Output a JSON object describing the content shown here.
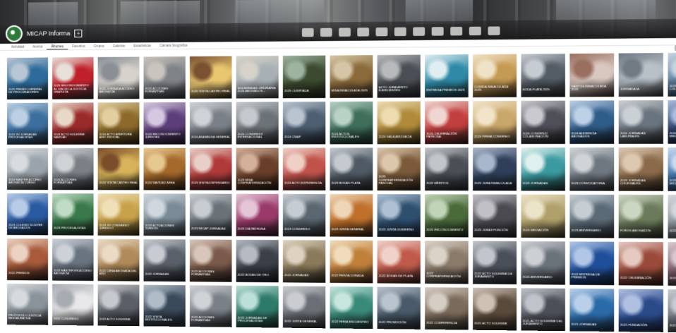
{
  "profile": {
    "title": "MICAP Informa",
    "add_symbol": "+"
  },
  "stats": [
    "",
    "",
    ""
  ],
  "cover_actions": [
    "",
    ""
  ],
  "tabs": [
    {
      "label": "Actividad",
      "active": false
    },
    {
      "label": "Acerca",
      "active": false
    },
    {
      "label": "Álbumes",
      "active": true
    },
    {
      "label": "Favoritos",
      "active": false
    },
    {
      "label": "Grupos",
      "active": false
    },
    {
      "label": "Galerías",
      "active": false
    },
    {
      "label": "Estadísticas",
      "active": false
    },
    {
      "label": "Cámara fotográfica",
      "active": false
    }
  ],
  "tile_meta": "",
  "tiles": [
    {
      "title": "2025 PREMIO GENERAL DE PROCURADORES",
      "palette": [
        "#2c6b9a",
        "#b9c7d4",
        "#1d1f22"
      ]
    },
    {
      "title": "2025 RECONOCIMIENTO AL DÍA DE LA JUSTICIA GRATUITA",
      "palette": [
        "#c0202a",
        "#e6e0d8",
        "#2c2c2f"
      ]
    },
    {
      "title": "2025 JORNADA ACCESO ABOGACÍA",
      "palette": [
        "#d7d3cc",
        "#8a8f96",
        "#3b3c40"
      ]
    },
    {
      "title": "2025 ACCIONES FORMATIVAS",
      "palette": [
        "#7f8287",
        "#c9c4bd",
        "#2b2d31"
      ]
    },
    {
      "title": "2025 Visita Castro Real",
      "palette": [
        "#e9c770",
        "#7a5232",
        "#2c2219"
      ]
    },
    {
      "title": "Solemnidad Ordinaria 2025 Abogados...",
      "palette": [
        "#a7b0b4",
        "#d6d2c9",
        "#3b3a3a"
      ]
    },
    {
      "title": "2025 Olimpiada",
      "palette": [
        "#3c4b2f",
        "#9fb4a0",
        "#20241e"
      ]
    },
    {
      "title": "Misa Inmaculada 2025",
      "palette": [
        "#8a6a3a",
        "#d6c6a7",
        "#2a2420"
      ]
    },
    {
      "title": "Acto Juramento Ejercientes",
      "palette": [
        "#4a4f55",
        "#b7b9bb",
        "#222428"
      ]
    },
    {
      "title": "Entrega Premios 2025",
      "palette": [
        "#2e8aa7",
        "#e0eef2",
        "#1c2a30"
      ]
    },
    {
      "title": "Comida Inmaculada 2025",
      "palette": [
        "#c59a52",
        "#f0e2c6",
        "#3a2a1a"
      ]
    },
    {
      "title": "Boda Plata 2025",
      "palette": [
        "#545c66",
        "#c7ccd3",
        "#25282c"
      ]
    },
    {
      "title": "Santos Inmaculada 2025",
      "palette": [
        "#d9c8c0",
        "#9a6f5f",
        "#2c2422"
      ]
    },
    {
      "title": "Jornada IA",
      "palette": [
        "#b8c0c8",
        "#707a84",
        "#2a2e33"
      ]
    },
    {
      "title": "2025 Asamblea Colegial",
      "palette": [
        "#5a7fa0",
        "#c8d5e0",
        "#202630"
      ]
    },
    {
      "title": "2024 XV Jornadas Procesalistas",
      "palette": [
        "#3c6e9e",
        "#bcd0e2",
        "#1f2530"
      ]
    },
    {
      "title": "2024 Acto Solemne Navidad",
      "palette": [
        "#9b2a2a",
        "#e8d8c8",
        "#2a1c1c"
      ]
    },
    {
      "title": "2024 Acto Apertura Año Judicial",
      "palette": [
        "#8c6a2a",
        "#e2cfa0",
        "#2a2114"
      ]
    },
    {
      "title": "2024 Reconocimiento Juristas",
      "palette": [
        "#5c3f7a",
        "#d6c8e2",
        "#241c2c"
      ]
    },
    {
      "title": "2024 Asamblea General",
      "palette": [
        "#7a8088",
        "#cfd2d6",
        "#26282c"
      ]
    },
    {
      "title": "2024 Congreso Internacional",
      "palette": [
        "#6c7378",
        "#c4c9cd",
        "#24272a"
      ]
    },
    {
      "title": "2024 CMAP",
      "palette": [
        "#4d5f72",
        "#b9c4cf",
        "#20262d"
      ]
    },
    {
      "title": "2024 Actos Institucionales",
      "palette": [
        "#3f6f5a",
        "#b8d2c6",
        "#1c2a24"
      ]
    },
    {
      "title": "2024 Gala Abogacía",
      "palette": [
        "#b08a3a",
        "#ecdcb0",
        "#2c2414"
      ]
    },
    {
      "title": "2024 Celebración Patrona",
      "palette": [
        "#c23f3f",
        "#f0d6d0",
        "#2e1c1c"
      ]
    },
    {
      "title": "2024 Firma Convenio",
      "palette": [
        "#c9a66a",
        "#f2e4c8",
        "#30281c"
      ]
    },
    {
      "title": "2024 Convenio Colaboración",
      "palette": [
        "#4f4f58",
        "#c9c9cf",
        "#222226"
      ]
    },
    {
      "title": "2024 Audiencia Abogados",
      "palette": [
        "#2f5d8a",
        "#bcd0e6",
        "#1c2430"
      ]
    },
    {
      "title": "2024 Jornadas Laborales",
      "palette": [
        "#6a747e",
        "#cbd0d5",
        "#25282b"
      ]
    },
    {
      "title": "2024 Seminario Mediación",
      "palette": [
        "#2b3f6a",
        "#a9bde0",
        "#182030"
      ]
    },
    {
      "title": "2024 MASTER ACCESO ABOGACÍA CURSO",
      "palette": [
        "#9aa3ab",
        "#d8dcdf",
        "#2d3034"
      ]
    },
    {
      "title": "2024 ACCIONES FORMATIVAS",
      "palette": [
        "#7a8086",
        "#d0d3d6",
        "#26282b"
      ]
    },
    {
      "title": "2024 Visita Castro Real",
      "palette": [
        "#d8b35a",
        "#7a4e2a",
        "#2c2016"
      ]
    },
    {
      "title": "2024 NAVIDAD ÁREA",
      "palette": [
        "#a4682a",
        "#e6c890",
        "#2c1e12"
      ]
    },
    {
      "title": "2023 VISITA DISPENSARIO",
      "palette": [
        "#b03a3a",
        "#e8cfc8",
        "#2c1a1a"
      ]
    },
    {
      "title": "2023 MISA CONFRATERNIZACIÓN",
      "palette": [
        "#6a3f2a",
        "#d2b09a",
        "#24180f"
      ]
    },
    {
      "title": "2023 ACTO EXPERIENCIA",
      "palette": [
        "#c0524a",
        "#efd0c6",
        "#2e1e1a"
      ]
    },
    {
      "title": "2023 BODAS PLATA",
      "palette": [
        "#505a64",
        "#c4cad0",
        "#22262a"
      ]
    },
    {
      "title": "2023 CONFRATERNIZACIÓN PASCUAL",
      "palette": [
        "#7a5a3a",
        "#dcc6ac",
        "#2a2016"
      ]
    },
    {
      "title": "2023 MÉRITOS",
      "palette": [
        "#4a4f55",
        "#c2c6ca",
        "#232528"
      ]
    },
    {
      "title": "2023 JURA INMACULADA",
      "palette": [
        "#2f3f5a",
        "#aab6ca",
        "#1a1f28"
      ]
    },
    {
      "title": "2023 JORNADAS",
      "palette": [
        "#3a9aa0",
        "#e0f0ee",
        "#1c2c2e"
      ]
    },
    {
      "title": "2023 CONVOCATORIA",
      "palette": [
        "#6f7880",
        "#cfd4d8",
        "#25292c"
      ]
    },
    {
      "title": "2023 JORNADAS COLEGIALES",
      "palette": [
        "#8a6a4a",
        "#ddc8b0",
        "#2a2218"
      ]
    },
    {
      "title": "2023 Inauguración MICAP Laboral",
      "palette": [
        "#3a6ea8",
        "#cadcf0",
        "#1a2434"
      ]
    },
    {
      "title": "2023 Colegio Ilustre de Abogados",
      "palette": [
        "#2a5aa0",
        "#b8cce8",
        "#182030"
      ]
    },
    {
      "title": "2023 Procesalistas",
      "palette": [
        "#3a7a4a",
        "#c0dcc6",
        "#1a2a1e"
      ]
    },
    {
      "title": "2023 XV Congreso Jurídico",
      "palette": [
        "#c8a24a",
        "#efe0b8",
        "#2e2616"
      ]
    },
    {
      "title": "2023 Actuaciones Turnos",
      "palette": [
        "#7a8a96",
        "#d0d8de",
        "#262c30"
      ]
    },
    {
      "title": "2023 MICAP Jornadas",
      "palette": [
        "#6a7278",
        "#c8cdd1",
        "#24272a"
      ]
    },
    {
      "title": "2023 Día Patrona",
      "palette": [
        "#9a3a6a",
        "#e4c6d6",
        "#2a1a24"
      ]
    },
    {
      "title": "2023 Congreso",
      "palette": [
        "#5a6670",
        "#c6ccd2",
        "#22262a"
      ]
    },
    {
      "title": "2023 Junta General",
      "palette": [
        "#c0702a",
        "#f0d6b8",
        "#2c2014"
      ]
    },
    {
      "title": "2023 Junta Gobierno",
      "palette": [
        "#2f4f6f",
        "#aec0d2",
        "#1a2230"
      ]
    },
    {
      "title": "2023 Reconocimiento",
      "palette": [
        "#4a6a3a",
        "#c2d4b8",
        "#1e2818"
      ]
    },
    {
      "title": "2023 JURAS FUNCIÓN",
      "palette": [
        "#4a4a50",
        "#c0c0c6",
        "#222224"
      ]
    },
    {
      "title": "2023 Mediación",
      "palette": [
        "#b0a06a",
        "#ece4c8",
        "#2c281c"
      ]
    },
    {
      "title": "2023 Aniversario",
      "palette": [
        "#5a6a76",
        "#c6ced4",
        "#24282c"
      ]
    },
    {
      "title": "FOROS ABOGADOS",
      "palette": [
        "#6a7a5a",
        "#cdd6c2",
        "#262a20"
      ]
    },
    {
      "title": "2023 MICAP Laboral",
      "palette": [
        "#8a949c",
        "#d4d8dc",
        "#2a2c2e"
      ]
    },
    {
      "title": "2022 PREMIOS",
      "palette": [
        "#a85a3a",
        "#ecd2c2",
        "#2c1c16"
      ]
    },
    {
      "title": "2022 MASTER EN ACCESO ABOGACÍA",
      "palette": [
        "#6a7480",
        "#cdd2d8",
        "#24282c"
      ]
    },
    {
      "title": "2022 CENA Abogada del año",
      "palette": [
        "#b08a5a",
        "#eadbc6",
        "#2c241a"
      ]
    },
    {
      "title": "2022 JORNADAS",
      "palette": [
        "#5a606a",
        "#c8ccd2",
        "#222428"
      ]
    },
    {
      "title": "2022 ACCIONES FORMATIVAS",
      "palette": [
        "#7a5a4a",
        "#d8c6ba",
        "#2a201c"
      ]
    },
    {
      "title": "2022 BODAS DE ORO",
      "palette": [
        "#3a3f48",
        "#b6bac2",
        "#1c1e22"
      ]
    },
    {
      "title": "2022 JORNADAS",
      "palette": [
        "#8a7a5a",
        "#ddd3c0",
        "#2a261c"
      ]
    },
    {
      "title": "2022 FIESTA DORADA",
      "palette": [
        "#c0803a",
        "#f0dcbc",
        "#2e2216"
      ]
    },
    {
      "title": "2022 BODAS DE PLATA",
      "palette": [
        "#c05a4a",
        "#f0d2ca",
        "#2e1c18"
      ]
    },
    {
      "title": "2022 CONFRATERNIZACIÓN",
      "palette": [
        "#8a7a6a",
        "#dbd2c8",
        "#2a2622"
      ]
    },
    {
      "title": "2022 ACTO SOLEMNE DE JURAMENTO",
      "palette": [
        "#4a505a",
        "#c2c6cc",
        "#222428"
      ]
    },
    {
      "title": "2022 ANIVERSARIO",
      "palette": [
        "#6a727a",
        "#ccd0d4",
        "#24272a"
      ]
    },
    {
      "title": "2022 ENTREGA DE PREMIOS",
      "palette": [
        "#1f4f9a",
        "#b2c6e8",
        "#141c2e"
      ]
    },
    {
      "title": "2022 CELEBRACIÓN",
      "palette": [
        "#9a4a3a",
        "#e6cac2",
        "#2a1a16"
      ]
    },
    {
      "title": "2022 DÍAS DE FIESTA",
      "palette": [
        "#7a5a6a",
        "#dac8d0",
        "#281e22"
      ]
    },
    {
      "title": "PROTOCOLO JUSTICIA RESTAURATIVA",
      "palette": [
        "#8a929a",
        "#d6dadd",
        "#2a2c2e"
      ]
    },
    {
      "title": "XXIV CONGRESO",
      "palette": [
        "#e8e8ea",
        "#a8acb2",
        "#3a3c40"
      ]
    },
    {
      "title": "2022 ACTO SOLEMNE",
      "palette": [
        "#5a5f66",
        "#c6c9cd",
        "#222426"
      ]
    },
    {
      "title": "2022 VISITA INSTITUCIONALES",
      "palette": [
        "#3a4a5a",
        "#b0bcc8",
        "#1c2228"
      ]
    },
    {
      "title": "2022 ACCIONES FORMATIVAS",
      "palette": [
        "#7a8088",
        "#d0d3d6",
        "#26282b"
      ]
    },
    {
      "title": "2022 JORNADAS DE PROCESALISTAS",
      "palette": [
        "#2e7a6a",
        "#bce0d8",
        "#1a2a26"
      ]
    },
    {
      "title": "2022 JUNTA GENERAL",
      "palette": [
        "#6a6f76",
        "#caccd0",
        "#242628"
      ]
    },
    {
      "title": "2022 FERIA ENCUENTRO",
      "palette": [
        "#3a8a7a",
        "#c6e6de",
        "#1c2c28"
      ]
    },
    {
      "title": "2021 PROMOCIÓN",
      "palette": [
        "#4a5a6a",
        "#bac4ce",
        "#1e242a"
      ]
    },
    {
      "title": "2021 CONFERENCIA",
      "palette": [
        "#7a6a5a",
        "#d6cec4",
        "#28241e"
      ]
    },
    {
      "title": "2021 ACTO SOLEMNE",
      "palette": [
        "#5a4a3a",
        "#cec2b6",
        "#241e18"
      ]
    },
    {
      "title": "2021 ACTO SOLEMNE DEL JURAMENTO",
      "palette": [
        "#4a4f58",
        "#c0c4ca",
        "#202226"
      ]
    },
    {
      "title": "2021 JORNADAS",
      "palette": [
        "#2a6aa8",
        "#bad0ea",
        "#182232"
      ]
    },
    {
      "title": "2021 FUNDACIÓN",
      "palette": [
        "#2a4a8a",
        "#b0c0e2",
        "#161e30"
      ]
    },
    {
      "title": "2021 ENCUENTRO",
      "palette": [
        "#6a707a",
        "#c8ccd2",
        "#222428"
      ]
    }
  ]
}
